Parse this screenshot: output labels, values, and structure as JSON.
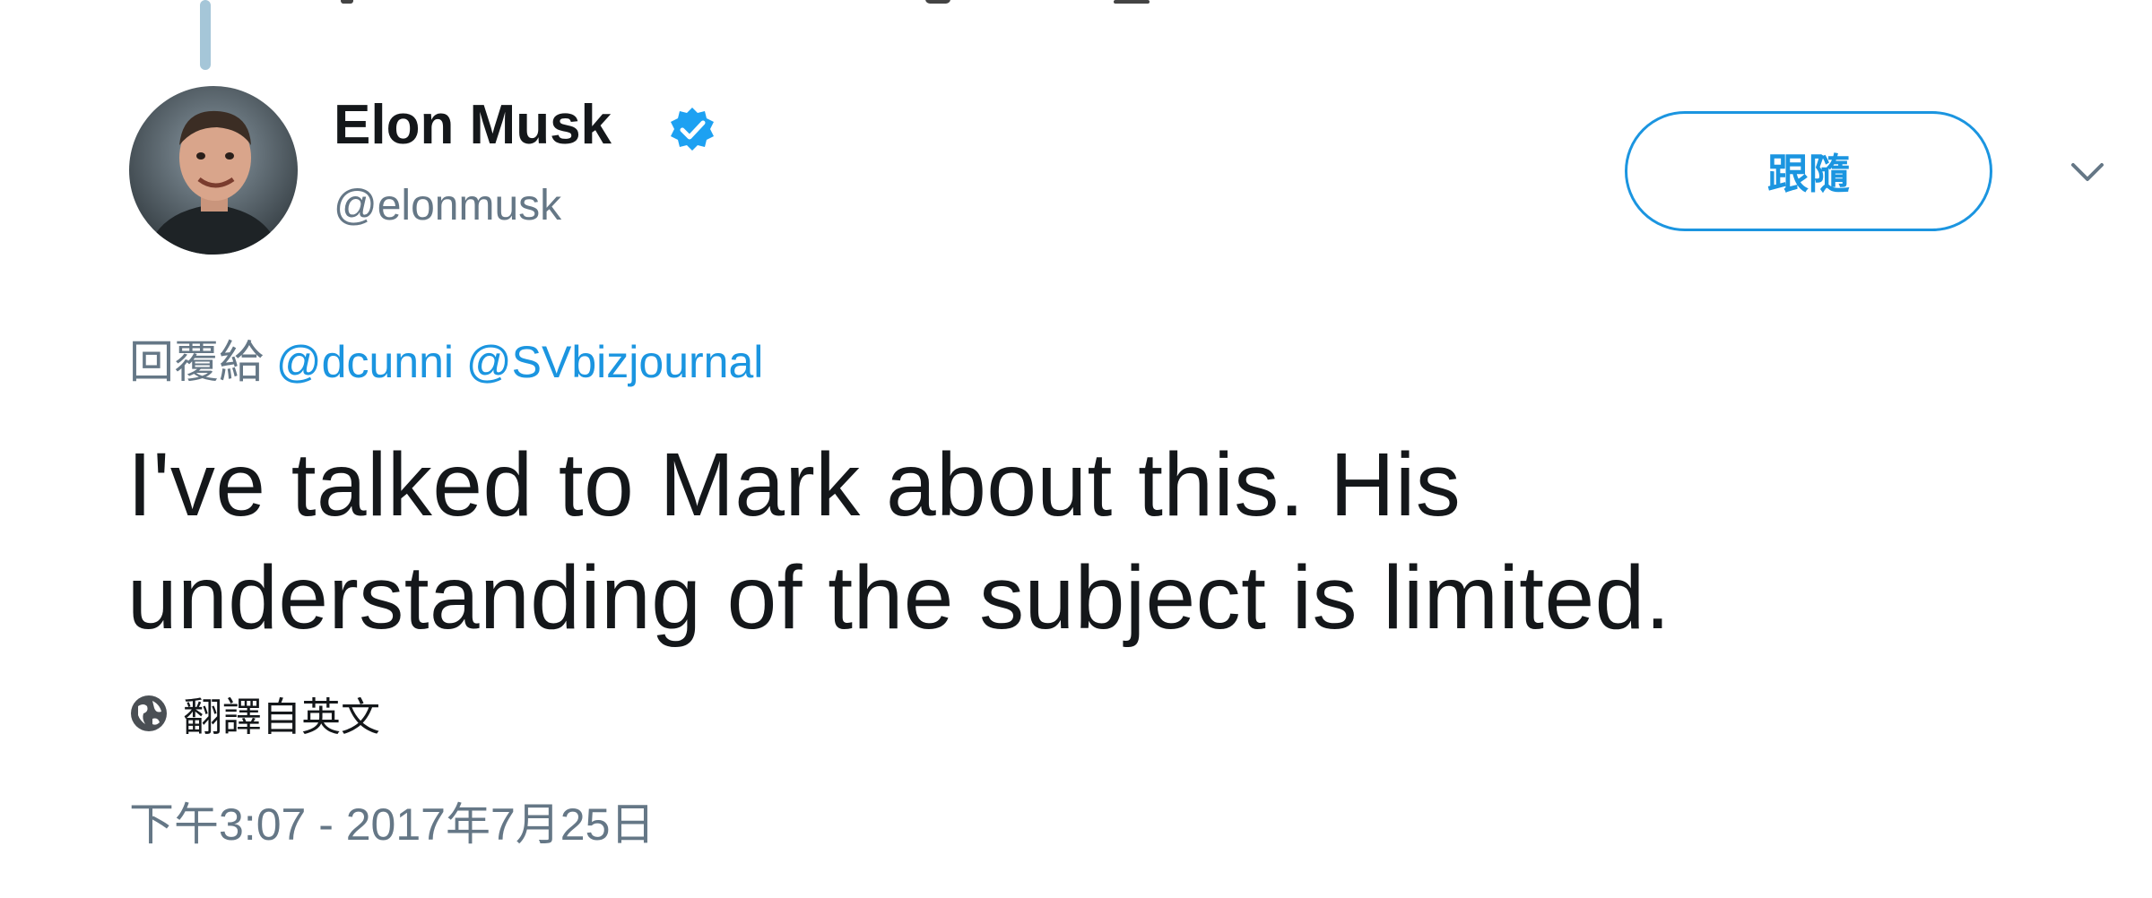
{
  "author": {
    "display_name": "Elon Musk",
    "username": "@elonmusk",
    "verified": true
  },
  "actions": {
    "follow_label": "跟隨"
  },
  "reply": {
    "prefix": "回覆給",
    "mentions": [
      "@dcunni",
      "@SVbizjournal"
    ]
  },
  "tweet": {
    "text": "I've talked to Mark about this. His understanding of the subject is limited."
  },
  "translate": {
    "label": "翻譯自英文"
  },
  "meta": {
    "timestamp": "下午3:07 - 2017年7月25日"
  },
  "colors": {
    "link": "#1b95e0",
    "secondary_text": "#657786",
    "primary_text": "#14171a",
    "thread_line": "#a5c6d8"
  },
  "icons": {
    "verified": "verified-badge-icon",
    "menu": "chevron-down-icon",
    "translate": "globe-icon"
  }
}
